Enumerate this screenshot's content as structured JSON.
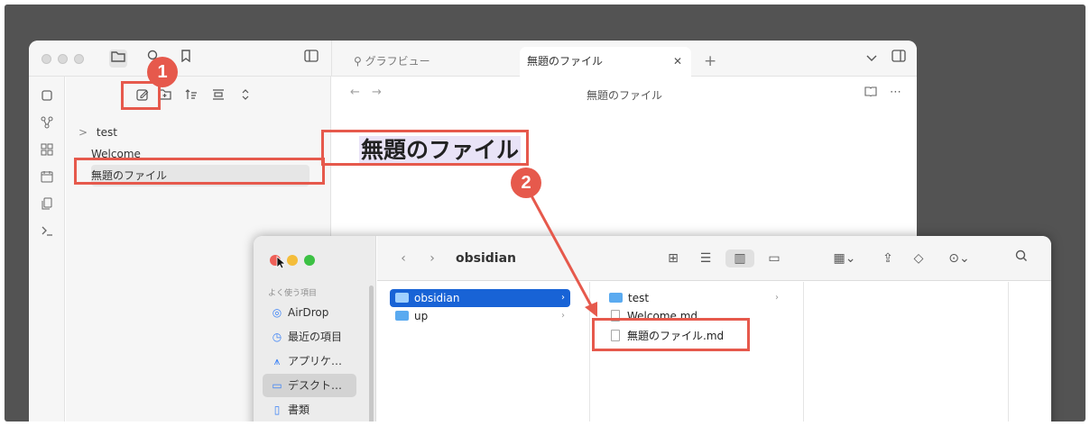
{
  "obsidian": {
    "tabs": {
      "graph": "グラフビュー",
      "active": "無題のファイル",
      "close": "✕",
      "new": "+"
    },
    "editor": {
      "header": "無題のファイル",
      "title": "無題のファイル"
    },
    "tree": {
      "folder": "test",
      "file1": "Welcome",
      "file2": "無題のファイル"
    }
  },
  "finder": {
    "path": "obsidian",
    "favorites_heading": "よく使う項目",
    "sidebar": [
      "AirDrop",
      "最近の項目",
      "アプリケ…",
      "デスクト…",
      "書類"
    ],
    "col1": [
      "obsidian",
      "up"
    ],
    "col2": [
      "test",
      "Welcome.md",
      "無題のファイル.md"
    ]
  },
  "annotations": {
    "step1": "1",
    "step2": "2"
  },
  "colors": {
    "accent_red": "#e6594c",
    "finder_selection": "#1863d6",
    "title_highlight": "#e9e3f7"
  },
  "icons": [
    "folder-icon",
    "search-icon",
    "bookmark-icon",
    "sidebar-toggle-icon",
    "graph-icon",
    "new-note-icon",
    "new-folder-icon",
    "sort-icon",
    "collapse-icon",
    "expand-icon",
    "reading-view-icon",
    "more-icon",
    "airdrop-icon",
    "recent-icon",
    "apps-icon",
    "desktop-icon",
    "document-icon",
    "share-icon",
    "tag-icon",
    "search-icon"
  ]
}
